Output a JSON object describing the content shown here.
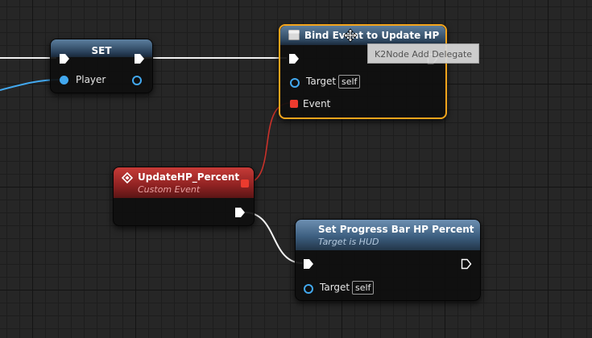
{
  "nodes": {
    "set": {
      "title": "SET",
      "player_label": "Player"
    },
    "bind_event": {
      "title": "Bind Event to Update HP",
      "target_label": "Target",
      "target_value": "self",
      "event_label": "Event"
    },
    "custom_event": {
      "title": "UpdateHP_Percent",
      "subtitle": "Custom Event"
    },
    "set_progress": {
      "title": "Set Progress Bar HP Percent",
      "subtitle": "Target is HUD",
      "target_label": "Target",
      "target_value": "self"
    }
  },
  "tooltip": {
    "text": "K2Node Add Delegate"
  },
  "colors": {
    "exec_wire": "#f2f2f2",
    "object_pin": "#42a8ef",
    "delegate_pin": "#ec3b2e",
    "selection": "#f3a41c",
    "custom_event_header": "#9c2424",
    "function_header": "#3d5f80"
  }
}
